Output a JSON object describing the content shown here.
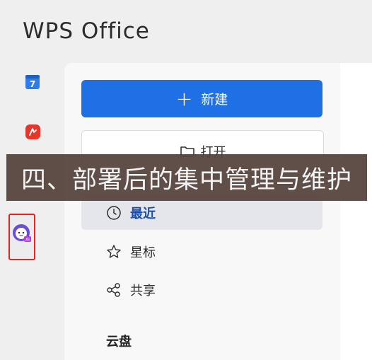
{
  "app": {
    "title": "WPS Office"
  },
  "sidebar": {
    "items": [
      {
        "name": "calendar",
        "icon": "calendar-icon",
        "badge": "7",
        "color": "#2f7be8"
      },
      {
        "name": "pdf",
        "icon": "pdf-icon",
        "color": "#e5362b"
      },
      {
        "name": "ai-assistant",
        "icon": "ai-assistant-icon",
        "badge": "AI",
        "highlight_color": "#e5231f"
      }
    ]
  },
  "panel": {
    "new_label": "新建",
    "open_label": "打开",
    "nav": [
      {
        "label": "最近",
        "icon": "clock-icon",
        "active": true
      },
      {
        "label": "星标",
        "icon": "star-icon",
        "active": false
      },
      {
        "label": "共享",
        "icon": "share-icon",
        "active": false
      }
    ],
    "section_title": "云盘"
  },
  "overlay": {
    "caption": "四、部署后的集中管理与维护"
  },
  "colors": {
    "primary": "#1f6fe5",
    "active_text": "#1f4ea8",
    "banner": "#54423a"
  }
}
